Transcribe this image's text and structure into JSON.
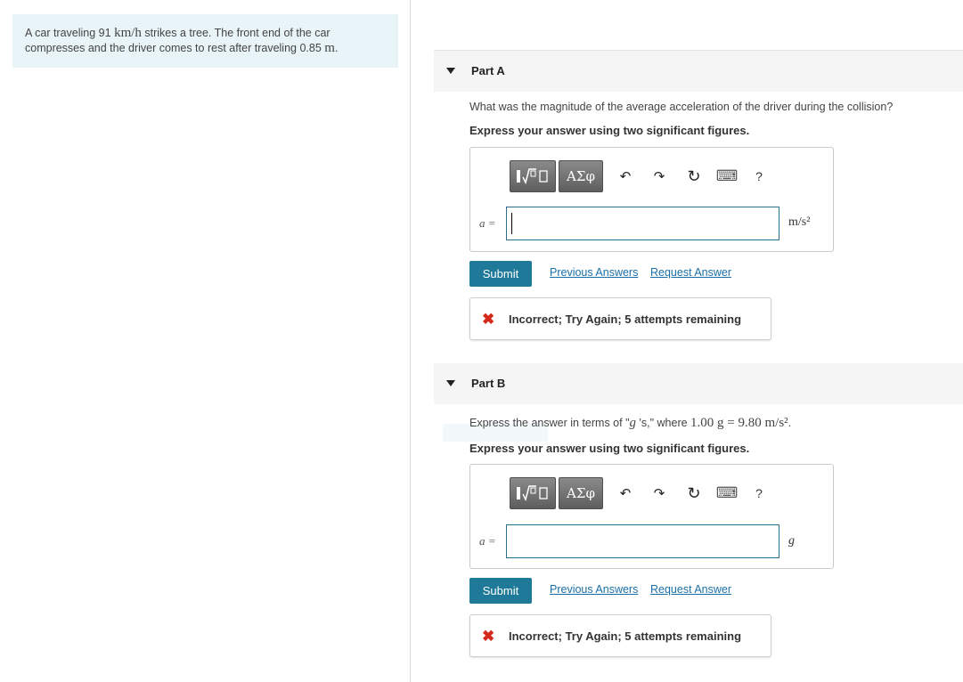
{
  "problem": {
    "text_1": "A car traveling 91 ",
    "speed_unit": "km/h",
    "text_2": " strikes a tree. The front end of the car compresses and the driver comes to rest after traveling 0.85 ",
    "dist_unit": "m",
    "text_3": "."
  },
  "toolbar": {
    "templates_icon": "template-icon",
    "greek_label": "ΑΣφ",
    "undo_glyph": "↶",
    "redo_glyph": "↷",
    "reset_glyph": "↻",
    "keyboard_glyph": "⌨",
    "help_label": "?"
  },
  "part_a": {
    "title": "Part A",
    "question": "What was the magnitude of the average acceleration of the driver during the collision?",
    "instruction": "Express your answer using two significant figures.",
    "var_label": "a =",
    "input_value": "",
    "unit": "m/s²",
    "submit_label": "Submit",
    "prev_answers_label": "Previous Answers",
    "request_answer_label": "Request Answer",
    "feedback_icon": "✖",
    "feedback": "Incorrect; Try Again; 5 attempts remaining"
  },
  "part_b": {
    "title": "Part B",
    "question_pre": "Express the answer in terms of \"",
    "question_g": "g",
    "question_mid": " 's,\" where ",
    "question_math": "1.00 g = 9.80 m/s²",
    "question_end": ".",
    "instruction": "Express your answer using two significant figures.",
    "var_label": "a =",
    "input_value": "",
    "unit": "g",
    "submit_label": "Submit",
    "prev_answers_label": "Previous Answers",
    "request_answer_label": "Request Answer",
    "feedback_icon": "✖",
    "feedback": "Incorrect; Try Again; 5 attempts remaining"
  },
  "colors": {
    "accent": "#1f7a99",
    "link": "#1a6fa8",
    "error": "#d42a1e",
    "problem_bg": "#e8f4f8"
  }
}
